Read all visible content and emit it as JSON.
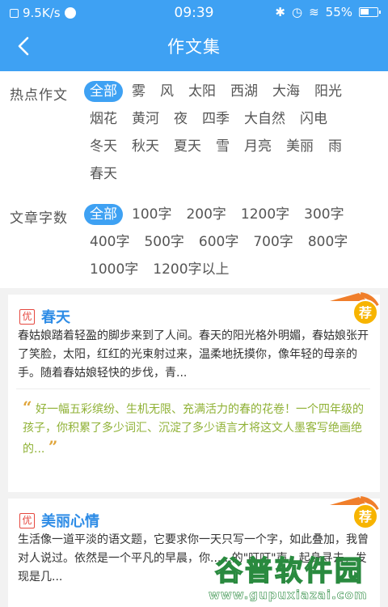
{
  "status_bar": {
    "net_speed": "9.5K/s",
    "time": "09:39",
    "battery": "55%"
  },
  "header": {
    "title": "作文集"
  },
  "filters": {
    "hot": {
      "label": "热点作文",
      "options": [
        "全部",
        "雾",
        "风",
        "太阳",
        "西湖",
        "大海",
        "阳光",
        "烟花",
        "黄河",
        "夜",
        "四季",
        "大自然",
        "闪电",
        "冬天",
        "秋天",
        "夏天",
        "雪",
        "月亮",
        "美丽",
        "雨",
        "春天"
      ],
      "selected": "全部"
    },
    "count": {
      "label": "文章字数",
      "options": [
        "全部",
        "100字",
        "200字",
        "1200字",
        "300字",
        "400字",
        "500字",
        "600字",
        "700字",
        "800字",
        "1000字",
        "1200字以上"
      ],
      "selected": "全部"
    }
  },
  "articles": [
    {
      "tag": "优",
      "title": "春天",
      "badge": "荐",
      "excerpt": "春姑娘踏着轻盈的脚步来到了人间。春天的阳光格外明媚，春姑娘张开了笑脸，太阳，红红的光束射过来，温柔地抚摸你，像年轻的母亲的手。随着春姑娘轻快的步伐，青...",
      "comment": "好一幅五彩缤纷、生机无限、充满活力的春的花卷！一个四年级的孩子，你积累了多少词汇、沉淀了多少语言才将这文人墨客写绝画绝的..."
    },
    {
      "tag": "优",
      "title": "美丽心情",
      "badge": "荐",
      "excerpt": "生活像一道平淡的语文题，它要求你一天只写一个字，如此叠加，我曾对人说过。依然是一个平凡的早晨，你......的\"叮叮\"声，起身寻去，发现是几..."
    }
  ],
  "watermark": {
    "title": "谷普软件园",
    "url": "www.gupuxiazai.com"
  },
  "colors": {
    "primary": "#3ea1f3",
    "title_blue": "#2e8ce6",
    "comment_green": "#8fb135",
    "tag_red": "#e5483f",
    "badge_orange": "#f07e2a"
  }
}
